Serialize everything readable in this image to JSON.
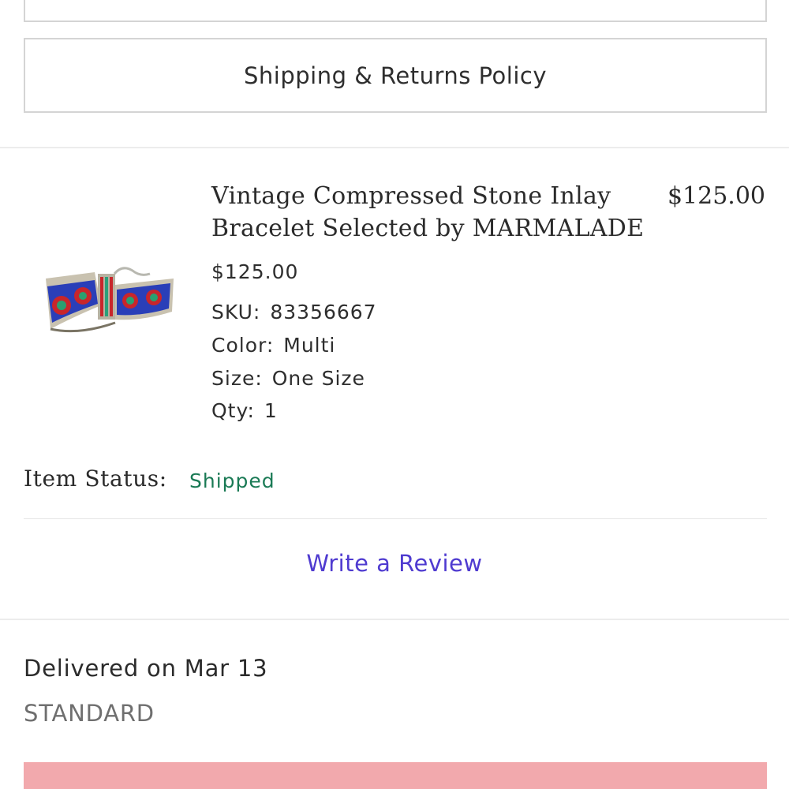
{
  "policy": {
    "shipping_returns_label": "Shipping & Returns Policy"
  },
  "item": {
    "title": "Vintage Compressed Stone Inlay Bracelet Selected by MARMALADE",
    "price_right": "$125.00",
    "price": "$125.00",
    "sku_label": "SKU:",
    "sku_value": "83356667",
    "color_label": "Color:",
    "color_value": "Multi",
    "size_label": "Size:",
    "size_value": "One Size",
    "qty_label": "Qty:",
    "qty_value": "1",
    "status_label": "Item Status:",
    "status_value": "Shipped",
    "status_color": "#1a7a55"
  },
  "review": {
    "label": "Write a Review",
    "color": "#4f3bd0"
  },
  "delivery": {
    "delivered_text": "Delivered on Mar 13",
    "method": "STANDARD"
  },
  "colors": {
    "bottom_button": "#f2a9ad",
    "border": "#d4d4d4"
  }
}
